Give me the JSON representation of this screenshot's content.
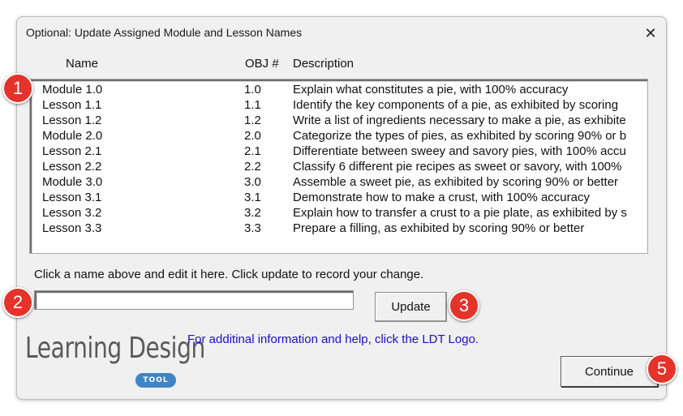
{
  "dialog": {
    "title": "Optional: Update Assigned Module and Lesson Names",
    "close_symbol": "✕"
  },
  "columns": {
    "name": "Name",
    "obj": "OBJ #",
    "description": "Description"
  },
  "rows": [
    {
      "name": "Module 1.0",
      "obj": "1.0",
      "description": "Explain what constitutes a pie, with 100% accuracy"
    },
    {
      "name": "Lesson 1.1",
      "obj": "1.1",
      "description": "Identify the key components of a pie, as exhibited by scoring"
    },
    {
      "name": "Lesson 1.2",
      "obj": "1.2",
      "description": "Write a list of ingredients necessary to make a pie, as exhibite"
    },
    {
      "name": "Module 2.0",
      "obj": "2.0",
      "description": "Categorize the types of pies, as exhibited by scoring 90% or b"
    },
    {
      "name": "Lesson 2.1",
      "obj": "2.1",
      "description": "Differentiate between sweey and savory pies, with 100% accu"
    },
    {
      "name": "Lesson 2.2",
      "obj": "2.2",
      "description": "Classify 6 different pie recipes as sweet or savory, with 100%"
    },
    {
      "name": "Module 3.0",
      "obj": "3.0",
      "description": "Assemble a sweet pie, as exhibited by scoring 90% or better"
    },
    {
      "name": "Lesson 3.1",
      "obj": "3.1",
      "description": "Demonstrate how to make a crust, with 100% accuracy"
    },
    {
      "name": "Lesson 3.2",
      "obj": "3.2",
      "description": "Explain how to transfer a crust to a pie plate, as exhibited by s"
    },
    {
      "name": "Lesson 3.3",
      "obj": "3.3",
      "description": "Prepare a filling, as exhibited by scoring 90% or better"
    }
  ],
  "editor": {
    "instruction": "Click a name above and edit it here. Click update to record your change.",
    "input_value": "",
    "update_label": "Update"
  },
  "help": {
    "link_text": "For additinal information and help, click the LDT Logo."
  },
  "logo": {
    "main_text": "Learning Design",
    "tag_text": "TOOL"
  },
  "continue_label": "Continue",
  "badges": [
    "1",
    "2",
    "3",
    "5"
  ],
  "colors": {
    "badge": "#e3332b",
    "link": "#1a10c8",
    "logo_tag": "#3f85c6"
  }
}
